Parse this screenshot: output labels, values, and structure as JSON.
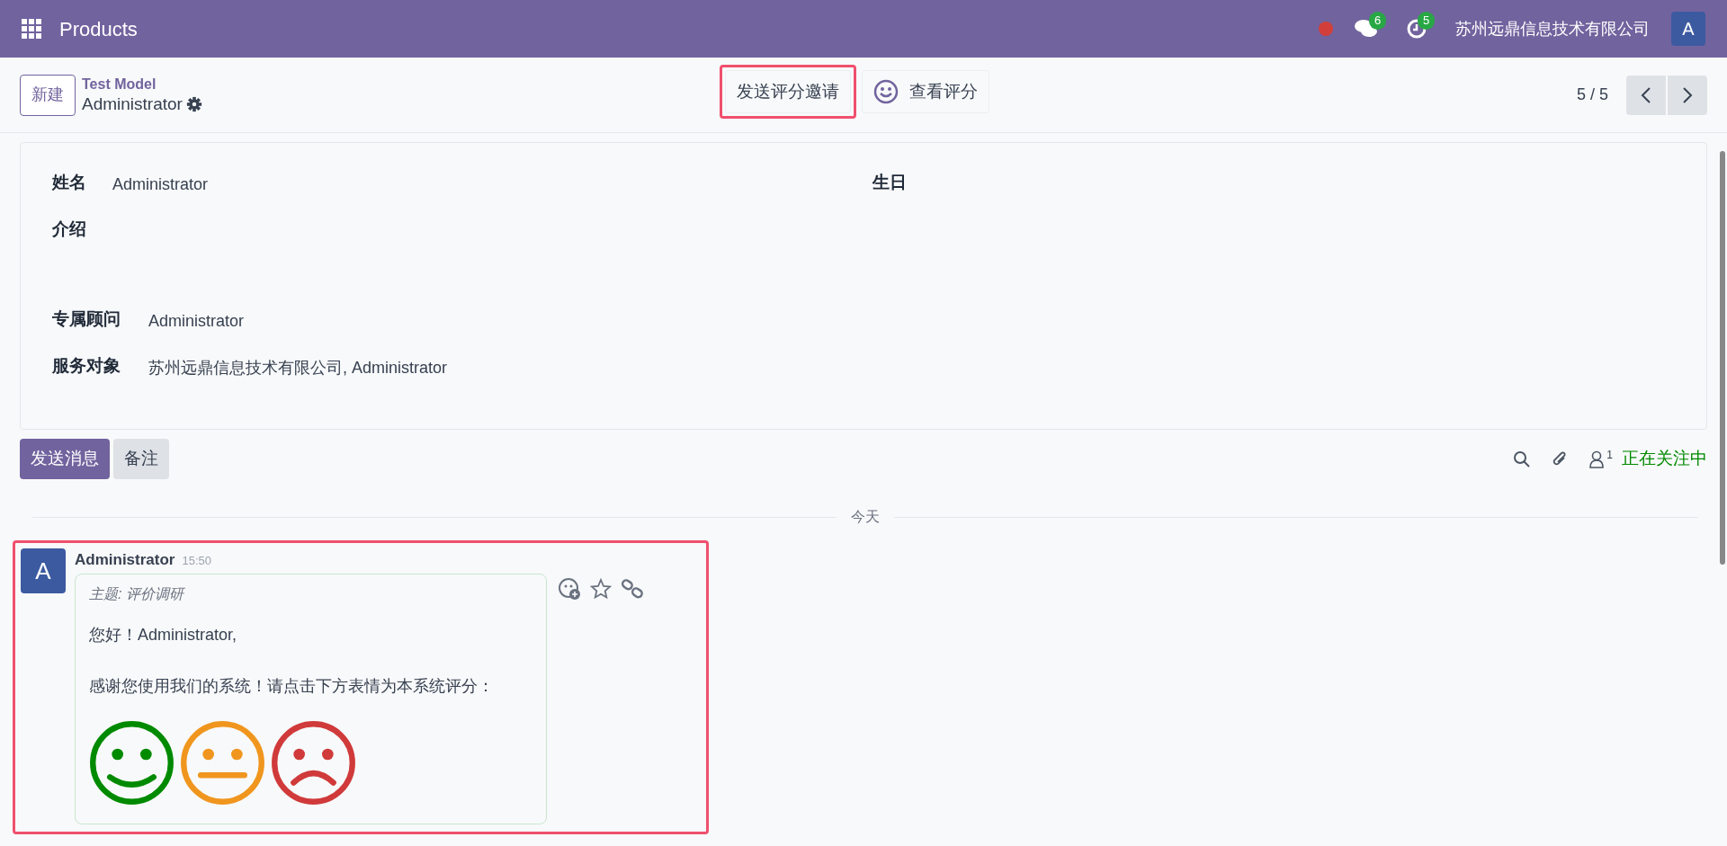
{
  "navbar": {
    "app_title": "Products",
    "messages_count": "6",
    "activities_count": "5",
    "company": "苏州远鼎信息技术有限公司",
    "avatar": "A"
  },
  "control_panel": {
    "new_button": "新建",
    "breadcrumb": "Test Model",
    "record": "Administrator",
    "actions": [
      {
        "kind": "plain",
        "label": "发送评分邀请",
        "highlighted": true
      },
      {
        "kind": "smiley",
        "label": "查看评分",
        "highlighted": false
      }
    ],
    "pager": "5 / 5"
  },
  "form": {
    "left": [
      {
        "label": "姓名",
        "value": "Administrator"
      },
      {
        "label": "介绍"
      },
      {
        "label": "专属顾问",
        "value": "Administrator"
      },
      {
        "label": "服务对象",
        "value": "苏州远鼎信息技术有限公司, Administrator"
      }
    ],
    "right": [
      {
        "label": "生日"
      }
    ]
  },
  "chatter": {
    "tabs": [
      {
        "label": "发送消息",
        "selected": true
      },
      {
        "label": "备注",
        "selected": false
      }
    ],
    "followers_count": "1",
    "follow_status": "正在关注中",
    "date_separator": "今天",
    "message": {
      "highlighted": true,
      "avatar": "A",
      "author": "Administrator",
      "time": "15:50",
      "subject": "主题: 评价调研",
      "lines": [
        "您好！Administrator,",
        "感谢您使用我们的系统！请点击下方表情为本系统评分："
      ],
      "ratings": [
        {
          "kind": "happy",
          "color": "#008a00"
        },
        {
          "kind": "neutral",
          "color": "#f0961e"
        },
        {
          "kind": "sad",
          "color": "#d03a3a"
        }
      ]
    }
  }
}
